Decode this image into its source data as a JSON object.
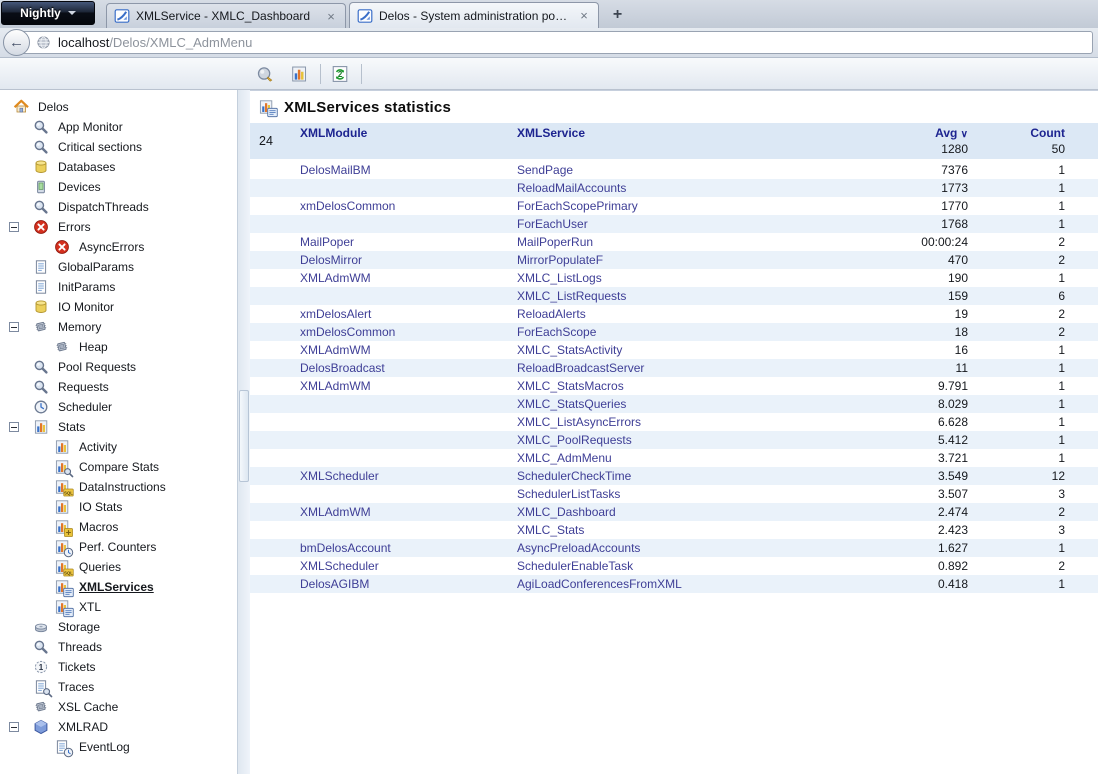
{
  "browser": {
    "app_button": {
      "label": "Nightly"
    },
    "tabs": [
      {
        "title": "XMLService - XMLC_Dashboard",
        "active": false
      },
      {
        "title": "Delos - System administration portal",
        "active": true
      }
    ],
    "close_label": "×",
    "new_tab_label": "+",
    "back_label": "←",
    "address": {
      "host": "localhost",
      "path": "/Delos/XMLC_AdmMenu"
    }
  },
  "toolbar": {
    "icons": [
      "zoom-tool",
      "stats-chart-tool",
      "refresh-frame-tool"
    ]
  },
  "sidebar": {
    "items": [
      {
        "label": "Delos",
        "icon": "home",
        "level": 0
      },
      {
        "label": "App Monitor",
        "icon": "magnifier",
        "level": 1
      },
      {
        "label": "Critical sections",
        "icon": "magnifier",
        "level": 1
      },
      {
        "label": "Databases",
        "icon": "database",
        "level": 1
      },
      {
        "label": "Devices",
        "icon": "device",
        "level": 1
      },
      {
        "label": "DispatchThreads",
        "icon": "magnifier",
        "level": 1
      },
      {
        "label": "Errors",
        "icon": "error",
        "level": 1,
        "expander": true
      },
      {
        "label": "AsyncErrors",
        "icon": "error",
        "level": 2
      },
      {
        "label": "GlobalParams",
        "icon": "document",
        "level": 1
      },
      {
        "label": "InitParams",
        "icon": "document",
        "level": 1
      },
      {
        "label": "IO Monitor",
        "icon": "database",
        "level": 1
      },
      {
        "label": "Memory",
        "icon": "chip",
        "level": 1,
        "expander": true
      },
      {
        "label": "Heap",
        "icon": "chip",
        "level": 2
      },
      {
        "label": "Pool Requests",
        "icon": "magnifier",
        "level": 1
      },
      {
        "label": "Requests",
        "icon": "magnifier",
        "level": 1
      },
      {
        "label": "Scheduler",
        "icon": "clock",
        "level": 1
      },
      {
        "label": "Stats",
        "icon": "chart",
        "level": 1,
        "expander": true
      },
      {
        "label": "Activity",
        "icon": "chart",
        "level": 2
      },
      {
        "label": "Compare Stats",
        "icon": "chart-magnifier",
        "level": 2
      },
      {
        "label": "DataInstructions",
        "icon": "chart-sql",
        "level": 2
      },
      {
        "label": "IO Stats",
        "icon": "chart",
        "level": 2
      },
      {
        "label": "Macros",
        "icon": "chart-plus",
        "level": 2
      },
      {
        "label": "Perf. Counters",
        "icon": "chart-clock",
        "level": 2
      },
      {
        "label": "Queries",
        "icon": "chart-sql",
        "level": 2
      },
      {
        "label": "XMLServices",
        "icon": "chart-form",
        "level": 2,
        "selected": true
      },
      {
        "label": "XTL",
        "icon": "chart-form",
        "level": 2
      },
      {
        "label": "Storage",
        "icon": "disk",
        "level": 1
      },
      {
        "label": "Threads",
        "icon": "magnifier",
        "level": 1
      },
      {
        "label": "Tickets",
        "icon": "ticket",
        "level": 1
      },
      {
        "label": "Traces",
        "icon": "doc-magnifier",
        "level": 1
      },
      {
        "label": "XSL Cache",
        "icon": "chip",
        "level": 1
      },
      {
        "label": "XMLRAD",
        "icon": "hexagon",
        "level": 1,
        "expander": true
      },
      {
        "label": "EventLog",
        "icon": "doc-clock",
        "level": 2
      }
    ]
  },
  "content": {
    "title": "XMLServices statistics",
    "table": {
      "row_count": "24",
      "columns": {
        "module": "XMLModule",
        "service": "XMLService",
        "avg": "Avg",
        "count": "Count"
      },
      "sort_indicator": "∨",
      "totals": {
        "avg": "1280",
        "count": "50"
      },
      "rows": [
        {
          "module": "DelosMailBM",
          "service": "SendPage",
          "avg": "7376",
          "count": "1"
        },
        {
          "module": "",
          "service": "ReloadMailAccounts",
          "avg": "1773",
          "count": "1"
        },
        {
          "module": "xmDelosCommon",
          "service": "ForEachScopePrimary",
          "avg": "1770",
          "count": "1"
        },
        {
          "module": "",
          "service": "ForEachUser",
          "avg": "1768",
          "count": "1"
        },
        {
          "module": "MailPoper",
          "service": "MailPoperRun",
          "avg": "00:00:24",
          "count": "2"
        },
        {
          "module": "DelosMirror",
          "service": "MirrorPopulateF",
          "avg": "470",
          "count": "2"
        },
        {
          "module": "XMLAdmWM",
          "service": "XMLC_ListLogs",
          "avg": "190",
          "count": "1"
        },
        {
          "module": "",
          "service": "XMLC_ListRequests",
          "avg": "159",
          "count": "6"
        },
        {
          "module": "xmDelosAlert",
          "service": "ReloadAlerts",
          "avg": "19",
          "count": "2"
        },
        {
          "module": "xmDelosCommon",
          "service": "ForEachScope",
          "avg": "18",
          "count": "2"
        },
        {
          "module": "XMLAdmWM",
          "service": "XMLC_StatsActivity",
          "avg": "16",
          "count": "1"
        },
        {
          "module": "DelosBroadcast",
          "service": "ReloadBroadcastServer",
          "avg": "11",
          "count": "1"
        },
        {
          "module": "XMLAdmWM",
          "service": "XMLC_StatsMacros",
          "avg": "9.791",
          "count": "1"
        },
        {
          "module": "",
          "service": "XMLC_StatsQueries",
          "avg": "8.029",
          "count": "1"
        },
        {
          "module": "",
          "service": "XMLC_ListAsyncErrors",
          "avg": "6.628",
          "count": "1"
        },
        {
          "module": "",
          "service": "XMLC_PoolRequests",
          "avg": "5.412",
          "count": "1"
        },
        {
          "module": "",
          "service": "XMLC_AdmMenu",
          "avg": "3.721",
          "count": "1"
        },
        {
          "module": "XMLScheduler",
          "service": "SchedulerCheckTime",
          "avg": "3.549",
          "count": "12"
        },
        {
          "module": "",
          "service": "SchedulerListTasks",
          "avg": "3.507",
          "count": "3"
        },
        {
          "module": "XMLAdmWM",
          "service": "XMLC_Dashboard",
          "avg": "2.474",
          "count": "2"
        },
        {
          "module": "",
          "service": "XMLC_Stats",
          "avg": "2.423",
          "count": "3"
        },
        {
          "module": "bmDelosAccount",
          "service": "AsyncPreloadAccounts",
          "avg": "1.627",
          "count": "1"
        },
        {
          "module": "XMLScheduler",
          "service": "SchedulerEnableTask",
          "avg": "0.892",
          "count": "2"
        },
        {
          "module": "DelosAGIBM",
          "service": "AgiLoadConferencesFromXML",
          "avg": "0.418",
          "count": "1"
        }
      ]
    }
  },
  "colors": {
    "header_band": "#dce8f5",
    "row_alt": "#eaf2fa",
    "header_text_navy": "#1d2490",
    "cell_text_indigo": "#3e3e96",
    "error_red": "#d4301e",
    "app_button_dark": "#1d2637",
    "chart_blue": "#3a72c8",
    "chart_orange": "#e2762a",
    "chart_yellow": "#e8c23a"
  }
}
